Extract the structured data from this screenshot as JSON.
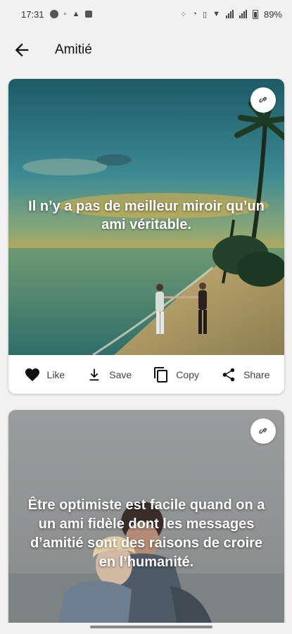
{
  "status_bar": {
    "time": "17:31",
    "battery": "89%"
  },
  "header": {
    "title": "Amitié"
  },
  "cards": [
    {
      "quote": "Il n’y a pas de meilleur miroir qu’un ami véritable.",
      "actions": {
        "like": "Like",
        "save": "Save",
        "copy": "Copy",
        "share": "Share"
      }
    },
    {
      "quote": "Être optimiste est facile quand on a un ami fidèle dont les messages d’amitié sont des raisons de croire en l’humanité."
    }
  ],
  "icons": [
    "back-arrow-icon",
    "link-icon",
    "heart-icon",
    "download-icon",
    "copy-icon",
    "share-icon"
  ]
}
